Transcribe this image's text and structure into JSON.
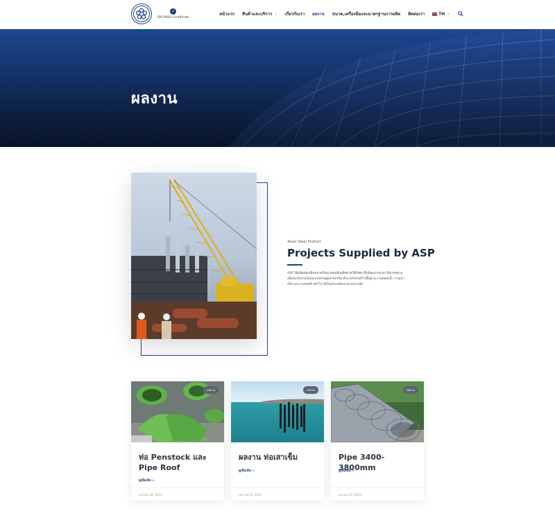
{
  "header": {
    "iso_text": "ISO 9001 Certificate",
    "nav": [
      {
        "label": "หน้าแรก",
        "dropdown": false,
        "active": false
      },
      {
        "label": "สินค้าและบริการ",
        "dropdown": true,
        "active": false
      },
      {
        "label": "เกี่ยวกับเรา",
        "dropdown": false,
        "active": false
      },
      {
        "label": "ผลงาน",
        "dropdown": false,
        "active": true
      },
      {
        "label": "ขนาด,เครื่องมือและมาตรฐานการผลิต",
        "dropdown": false,
        "active": false
      },
      {
        "label": "ติดต่อเรา",
        "dropdown": false,
        "active": false
      }
    ],
    "language": "TH"
  },
  "hero": {
    "title": "ผลงาน"
  },
  "feature": {
    "subtitle": "Asian Steel Product",
    "title": "Projects Supplied by ASP",
    "description": "ASP ได้ผลิตท่อเหล็กขนาดใหญ่ ท่อเหล็กผลิตด้วยวิธีพิเศษ ซึ่งมีคุณภาพและได้มาตรฐาน เพื่อรองรับงานในหลากหลายอุตสาหกรรม ทั้งงานโครงสร้างพื้นฐาน งานท่อส่งน้ำ งานเสาเข็ม และงานก่อสร้างทั่วไป ทั้งในประเทศและต่างประเทศ"
  },
  "cards": [
    {
      "badge": "ผลงาน",
      "title": "ท่อ Penstock และ Pipe Roof",
      "more": "ดูเพิ่มเติม »",
      "date": "เมษายน 20, 2023"
    },
    {
      "badge": "ผลงาน",
      "title": "ผลงาน ท่อเสาเข็ม",
      "more": "ดูเพิ่มเติม »",
      "date": "เมษายน 20, 2023"
    },
    {
      "badge": "ผลงาน",
      "title": "Pipe 3400-3800mm",
      "more": "ดูเพิ่มเติม »",
      "date": "เมษายน 20, 2023"
    }
  ],
  "colors": {
    "brand": "#1c3f87",
    "hero": "#183b7a"
  }
}
